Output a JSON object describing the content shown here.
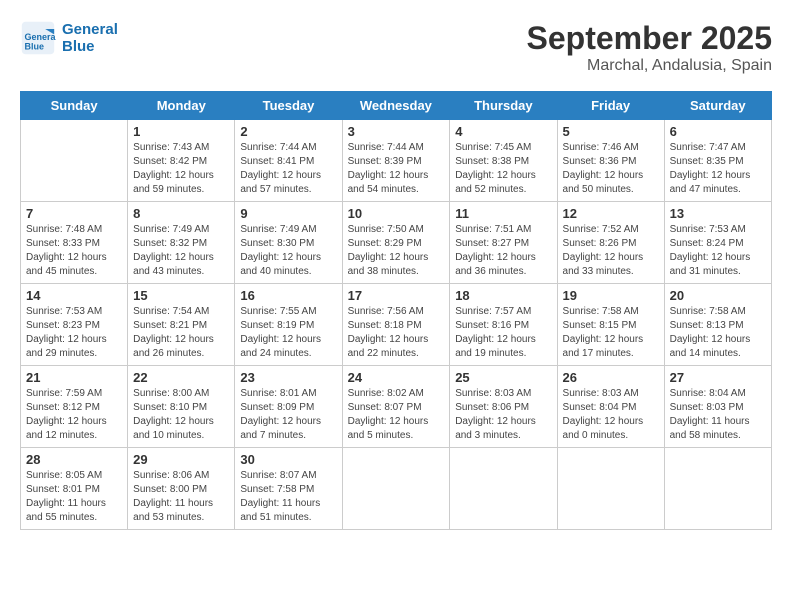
{
  "header": {
    "logo_line1": "General",
    "logo_line2": "Blue",
    "title": "September 2025",
    "subtitle": "Marchal, Andalusia, Spain"
  },
  "days_of_week": [
    "Sunday",
    "Monday",
    "Tuesday",
    "Wednesday",
    "Thursday",
    "Friday",
    "Saturday"
  ],
  "weeks": [
    [
      {
        "day": "",
        "info": ""
      },
      {
        "day": "1",
        "info": "Sunrise: 7:43 AM\nSunset: 8:42 PM\nDaylight: 12 hours\nand 59 minutes."
      },
      {
        "day": "2",
        "info": "Sunrise: 7:44 AM\nSunset: 8:41 PM\nDaylight: 12 hours\nand 57 minutes."
      },
      {
        "day": "3",
        "info": "Sunrise: 7:44 AM\nSunset: 8:39 PM\nDaylight: 12 hours\nand 54 minutes."
      },
      {
        "day": "4",
        "info": "Sunrise: 7:45 AM\nSunset: 8:38 PM\nDaylight: 12 hours\nand 52 minutes."
      },
      {
        "day": "5",
        "info": "Sunrise: 7:46 AM\nSunset: 8:36 PM\nDaylight: 12 hours\nand 50 minutes."
      },
      {
        "day": "6",
        "info": "Sunrise: 7:47 AM\nSunset: 8:35 PM\nDaylight: 12 hours\nand 47 minutes."
      }
    ],
    [
      {
        "day": "7",
        "info": "Sunrise: 7:48 AM\nSunset: 8:33 PM\nDaylight: 12 hours\nand 45 minutes."
      },
      {
        "day": "8",
        "info": "Sunrise: 7:49 AM\nSunset: 8:32 PM\nDaylight: 12 hours\nand 43 minutes."
      },
      {
        "day": "9",
        "info": "Sunrise: 7:49 AM\nSunset: 8:30 PM\nDaylight: 12 hours\nand 40 minutes."
      },
      {
        "day": "10",
        "info": "Sunrise: 7:50 AM\nSunset: 8:29 PM\nDaylight: 12 hours\nand 38 minutes."
      },
      {
        "day": "11",
        "info": "Sunrise: 7:51 AM\nSunset: 8:27 PM\nDaylight: 12 hours\nand 36 minutes."
      },
      {
        "day": "12",
        "info": "Sunrise: 7:52 AM\nSunset: 8:26 PM\nDaylight: 12 hours\nand 33 minutes."
      },
      {
        "day": "13",
        "info": "Sunrise: 7:53 AM\nSunset: 8:24 PM\nDaylight: 12 hours\nand 31 minutes."
      }
    ],
    [
      {
        "day": "14",
        "info": "Sunrise: 7:53 AM\nSunset: 8:23 PM\nDaylight: 12 hours\nand 29 minutes."
      },
      {
        "day": "15",
        "info": "Sunrise: 7:54 AM\nSunset: 8:21 PM\nDaylight: 12 hours\nand 26 minutes."
      },
      {
        "day": "16",
        "info": "Sunrise: 7:55 AM\nSunset: 8:19 PM\nDaylight: 12 hours\nand 24 minutes."
      },
      {
        "day": "17",
        "info": "Sunrise: 7:56 AM\nSunset: 8:18 PM\nDaylight: 12 hours\nand 22 minutes."
      },
      {
        "day": "18",
        "info": "Sunrise: 7:57 AM\nSunset: 8:16 PM\nDaylight: 12 hours\nand 19 minutes."
      },
      {
        "day": "19",
        "info": "Sunrise: 7:58 AM\nSunset: 8:15 PM\nDaylight: 12 hours\nand 17 minutes."
      },
      {
        "day": "20",
        "info": "Sunrise: 7:58 AM\nSunset: 8:13 PM\nDaylight: 12 hours\nand 14 minutes."
      }
    ],
    [
      {
        "day": "21",
        "info": "Sunrise: 7:59 AM\nSunset: 8:12 PM\nDaylight: 12 hours\nand 12 minutes."
      },
      {
        "day": "22",
        "info": "Sunrise: 8:00 AM\nSunset: 8:10 PM\nDaylight: 12 hours\nand 10 minutes."
      },
      {
        "day": "23",
        "info": "Sunrise: 8:01 AM\nSunset: 8:09 PM\nDaylight: 12 hours\nand 7 minutes."
      },
      {
        "day": "24",
        "info": "Sunrise: 8:02 AM\nSunset: 8:07 PM\nDaylight: 12 hours\nand 5 minutes."
      },
      {
        "day": "25",
        "info": "Sunrise: 8:03 AM\nSunset: 8:06 PM\nDaylight: 12 hours\nand 3 minutes."
      },
      {
        "day": "26",
        "info": "Sunrise: 8:03 AM\nSunset: 8:04 PM\nDaylight: 12 hours\nand 0 minutes."
      },
      {
        "day": "27",
        "info": "Sunrise: 8:04 AM\nSunset: 8:03 PM\nDaylight: 11 hours\nand 58 minutes."
      }
    ],
    [
      {
        "day": "28",
        "info": "Sunrise: 8:05 AM\nSunset: 8:01 PM\nDaylight: 11 hours\nand 55 minutes."
      },
      {
        "day": "29",
        "info": "Sunrise: 8:06 AM\nSunset: 8:00 PM\nDaylight: 11 hours\nand 53 minutes."
      },
      {
        "day": "30",
        "info": "Sunrise: 8:07 AM\nSunset: 7:58 PM\nDaylight: 11 hours\nand 51 minutes."
      },
      {
        "day": "",
        "info": ""
      },
      {
        "day": "",
        "info": ""
      },
      {
        "day": "",
        "info": ""
      },
      {
        "day": "",
        "info": ""
      }
    ]
  ]
}
